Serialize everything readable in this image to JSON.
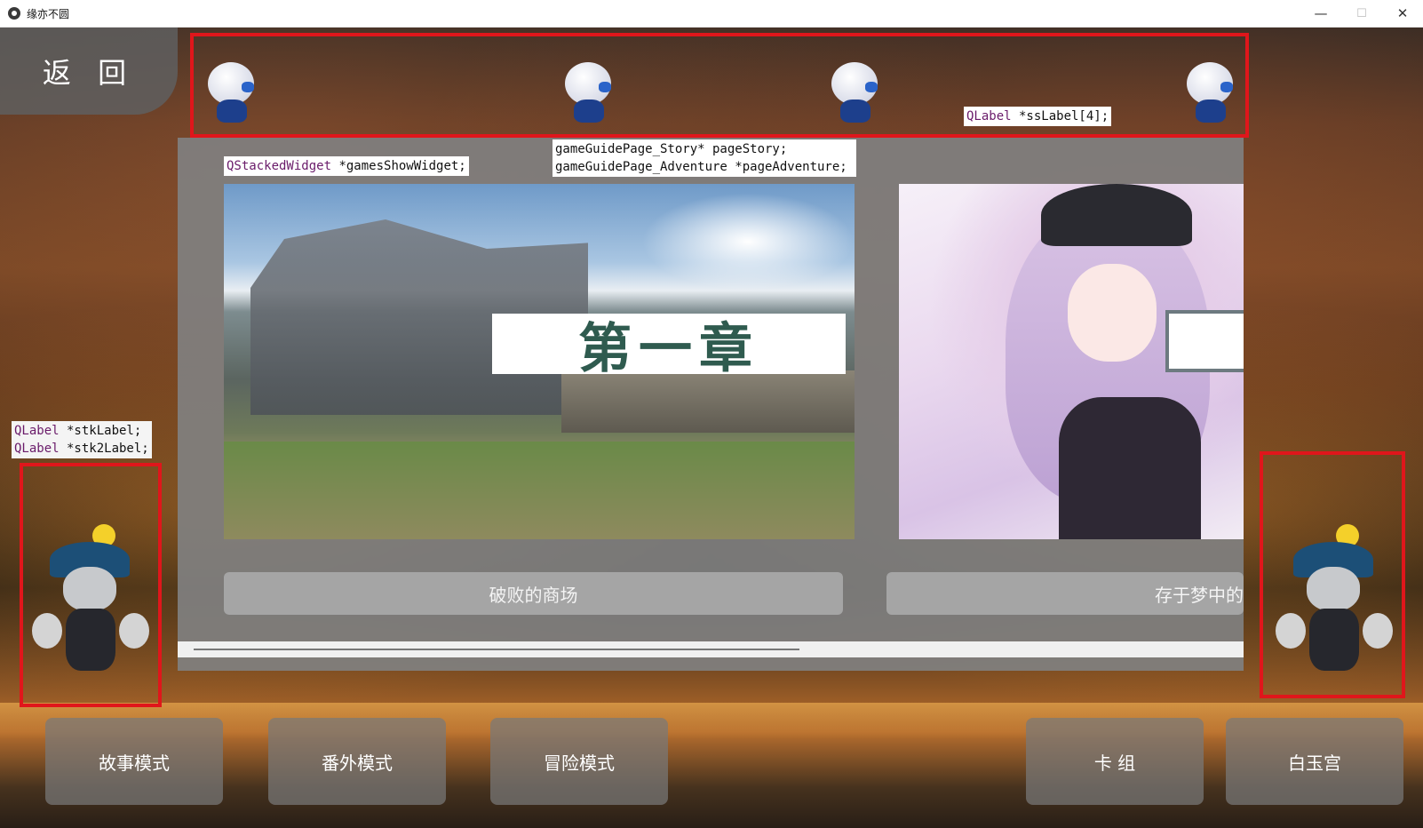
{
  "window": {
    "title": "缘亦不圆",
    "minimize_glyph": "—",
    "maximize_glyph": "☐",
    "close_glyph": "✕"
  },
  "back_button": {
    "label": "返 回"
  },
  "annotations": {
    "ss_label": {
      "type": "QLabel",
      "rest": " *ssLabel[4];"
    },
    "games_show_widget": {
      "type": "QStackedWidget",
      "rest": " *gamesShowWidget;"
    },
    "page_story": "gameGuidePage_Story* pageStory;",
    "page_adventure": "gameGuidePage_Adventure *pageAdventure;",
    "stk_label": {
      "type": "QLabel",
      "rest": " *stkLabel;"
    },
    "stk2_label": {
      "type": "QLabel",
      "rest": " *stk2Label;"
    }
  },
  "story_cards": [
    {
      "chapter_banner": "第一章",
      "button_label": "破败的商场"
    },
    {
      "chapter_banner": "",
      "button_label": "存于梦中的"
    }
  ],
  "mode_buttons": [
    {
      "label": "故事模式"
    },
    {
      "label": "番外模式"
    },
    {
      "label": "冒险模式"
    },
    {
      "label": "卡 组"
    },
    {
      "label": "白玉宫"
    }
  ],
  "colors": {
    "annotation_red": "#e0161b",
    "code_keyword": "#6a1b6a",
    "panel_gray": "#808080",
    "chapter_text": "#2f5b4f"
  }
}
